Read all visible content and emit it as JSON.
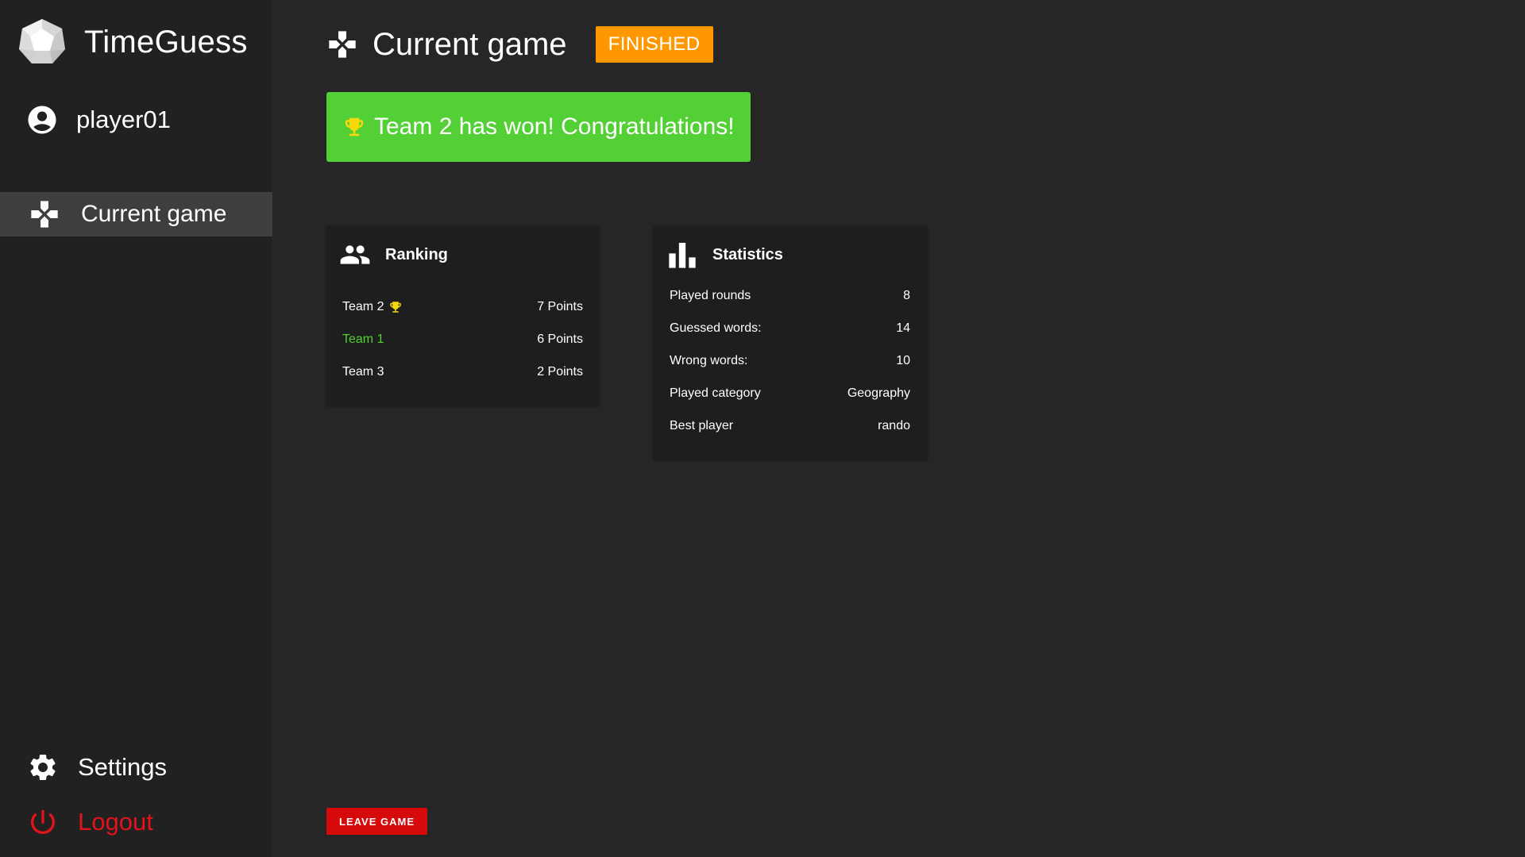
{
  "app": {
    "title": "TimeGuess",
    "logo_icon": "dodecahedron-logo"
  },
  "user": {
    "name": "player01",
    "icon": "account-circle-icon"
  },
  "sidebar": {
    "nav_items": [
      {
        "label": "Current game",
        "icon": "gamepad-icon",
        "active": true
      }
    ],
    "settings_label": "Settings",
    "logout_label": "Logout"
  },
  "header": {
    "title": "Current game",
    "icon": "gamepad-icon",
    "status": "FINISHED"
  },
  "banner": {
    "message": "Team 2 has won! Congratulations!",
    "icon": "trophy-icon"
  },
  "ranking": {
    "title": "Ranking",
    "icon": "group-icon",
    "rows": [
      {
        "team": "Team 2",
        "points": "7 Points",
        "winner": true,
        "highlight": false
      },
      {
        "team": "Team 1",
        "points": "6 Points",
        "winner": false,
        "highlight": true
      },
      {
        "team": "Team 3",
        "points": "2 Points",
        "winner": false,
        "highlight": false
      }
    ]
  },
  "statistics": {
    "title": "Statistics",
    "icon": "bar-chart-icon",
    "rows": [
      {
        "label": "Played rounds",
        "value": "8"
      },
      {
        "label": "Guessed words:",
        "value": "14"
      },
      {
        "label": "Wrong words:",
        "value": "10"
      },
      {
        "label": "Played category",
        "value": "Geography"
      },
      {
        "label": "Best player",
        "value": "rando"
      }
    ]
  },
  "actions": {
    "leave_label": "LEAVE GAME"
  },
  "colors": {
    "background": "#262626",
    "sidebar": "#212121",
    "active_nav": "#3e3e3e",
    "finished_badge": "#ff9800",
    "win_banner": "#52d035",
    "trophy": "#f5d90a",
    "highlight_team": "#52d035",
    "logout": "#e0141a",
    "leave_button": "#d60a0a"
  }
}
